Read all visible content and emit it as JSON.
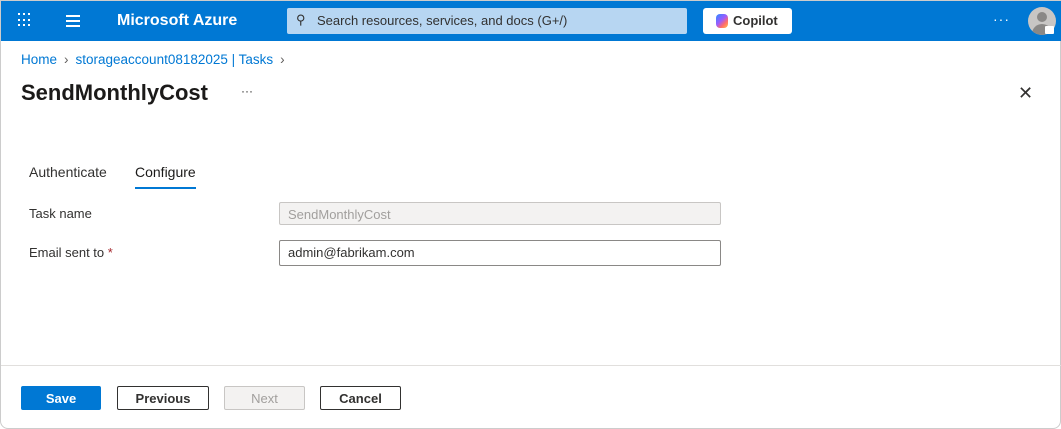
{
  "topbar": {
    "brand": "Microsoft Azure",
    "search_placeholder": "Search resources, services, and docs (G+/)",
    "copilot": "Copilot",
    "more": "···"
  },
  "breadcrumb": {
    "items": [
      "Home",
      "storageaccount08182025 | Tasks"
    ]
  },
  "page": {
    "title": "SendMonthlyCost",
    "more": "···",
    "close": "✕"
  },
  "tabs": [
    {
      "label": "Authenticate",
      "active": false
    },
    {
      "label": "Configure",
      "active": true
    }
  ],
  "form": {
    "task_name_label": "Task name",
    "task_name_value": "SendMonthlyCost",
    "email_label": "Email sent to",
    "required_mark": "*",
    "email_value": "admin@fabrikam.com"
  },
  "footer": {
    "save": "Save",
    "previous": "Previous",
    "next": "Next",
    "cancel": "Cancel"
  }
}
